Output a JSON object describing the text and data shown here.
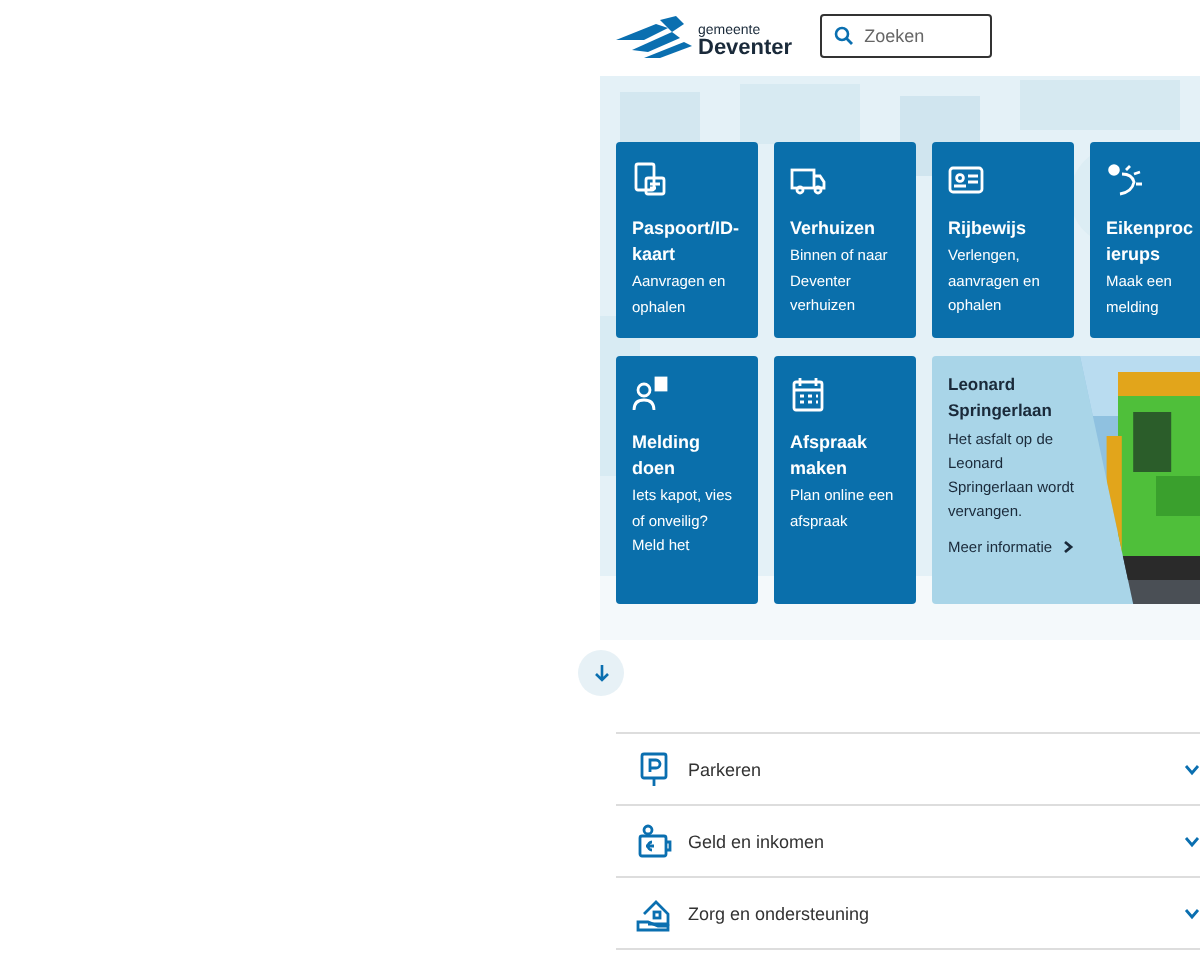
{
  "header": {
    "logo": {
      "small": "gemeente",
      "large": "Deventer"
    },
    "search": {
      "placeholder": "Zoeken"
    }
  },
  "tiles": [
    {
      "kind": "task",
      "title_lines": [
        "Paspoort/ID-",
        "kaart"
      ],
      "description": "Aanvragen en ophalen"
    },
    {
      "kind": "task",
      "title_lines": [
        "Verhuizen"
      ],
      "description": "Binnen of naar Deventer verhuizen"
    },
    {
      "kind": "task",
      "title_lines": [
        "Rijbewijs"
      ],
      "description": "Verlengen, aanvragen en ophalen"
    },
    {
      "kind": "task",
      "title_lines": [
        "Eikenproc",
        "ierups"
      ],
      "description": "Maak een melding"
    },
    {
      "kind": "task",
      "title_lines": [
        "Melding",
        "doen"
      ],
      "description": "Iets kapot, vies of onveilig? Meld het"
    },
    {
      "kind": "task",
      "title_lines": [
        "Afspraak",
        "maken"
      ],
      "description": "Plan online een afspraak"
    },
    {
      "kind": "news",
      "title_lines": [
        "Leonard",
        "Springerlaan"
      ],
      "description": "Het asfalt op de Leonard Springerlaan wordt vervangen.",
      "link": "Meer informatie"
    }
  ],
  "topics": [
    {
      "label": "Parkeren",
      "expanded": false
    },
    {
      "label": "Geld en inkomen",
      "expanded": false
    },
    {
      "label": "Zorg en ondersteuning",
      "expanded": false
    }
  ]
}
